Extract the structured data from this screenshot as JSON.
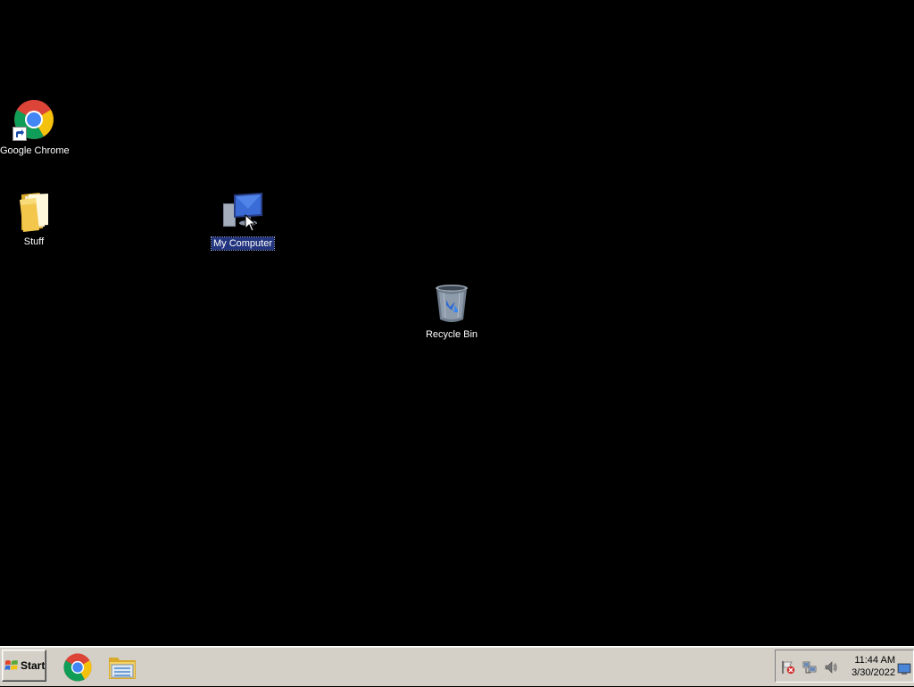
{
  "desktop": {
    "icons": [
      {
        "label": "Google Chrome",
        "icon": "chrome-icon",
        "selected": false
      },
      {
        "label": "Stuff",
        "icon": "folder-icon",
        "selected": false
      },
      {
        "label": "My Computer",
        "icon": "computer-icon",
        "selected": true
      },
      {
        "label": "Recycle Bin",
        "icon": "recycle-bin-icon",
        "selected": false
      }
    ],
    "background_color": "#000000",
    "selection_color": "#23357f"
  },
  "taskbar": {
    "start_label": "Start",
    "quick_launch": [
      {
        "icon": "chrome-icon"
      },
      {
        "icon": "file-explorer-icon"
      }
    ],
    "tray": {
      "icons": [
        "action-center-flag-icon",
        "network-icon",
        "volume-icon",
        "show-desktop-icon"
      ],
      "time": "11:44 AM",
      "date": "3/30/2022"
    },
    "background_color": "#d4d0c8"
  }
}
